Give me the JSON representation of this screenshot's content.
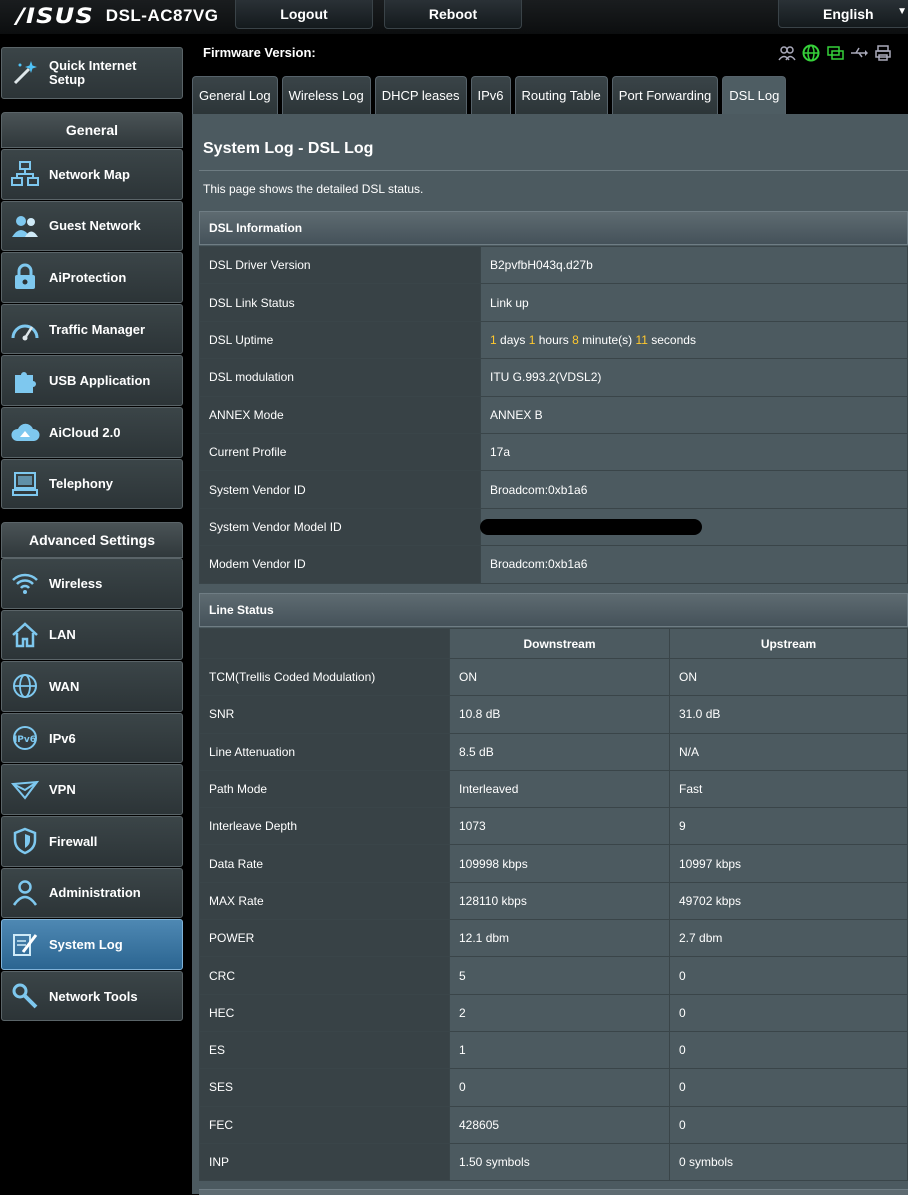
{
  "header": {
    "logo_text": "/ISUS",
    "model": "DSL-AC87VG",
    "logout_label": "Logout",
    "reboot_label": "Reboot",
    "language": "English"
  },
  "sidebar": {
    "quick_setup_line1": "Quick Internet",
    "quick_setup_line2": "Setup",
    "general_title": "General",
    "general_items": [
      {
        "label": "Network Map",
        "icon": "network-map-icon"
      },
      {
        "label": "Guest Network",
        "icon": "guest-network-icon"
      },
      {
        "label": "AiProtection",
        "icon": "lock-icon"
      },
      {
        "label": "Traffic Manager",
        "icon": "gauge-icon"
      },
      {
        "label": "USB Application",
        "icon": "puzzle-icon"
      },
      {
        "label": "AiCloud 2.0",
        "icon": "cloud-icon"
      },
      {
        "label": "Telephony",
        "icon": "telephony-icon"
      }
    ],
    "advanced_title": "Advanced Settings",
    "advanced_items": [
      {
        "label": "Wireless",
        "icon": "wifi-icon"
      },
      {
        "label": "LAN",
        "icon": "home-icon"
      },
      {
        "label": "WAN",
        "icon": "globe-icon"
      },
      {
        "label": "IPv6",
        "icon": "ipv6-icon"
      },
      {
        "label": "VPN",
        "icon": "vpn-icon"
      },
      {
        "label": "Firewall",
        "icon": "shield-icon"
      },
      {
        "label": "Administration",
        "icon": "admin-icon"
      },
      {
        "label": "System Log",
        "icon": "system-log-icon"
      },
      {
        "label": "Network Tools",
        "icon": "tools-icon"
      }
    ]
  },
  "firmware_label": "Firmware Version:",
  "tabs": [
    "General Log",
    "Wireless Log",
    "DHCP leases",
    "IPv6",
    "Routing Table",
    "Port Forwarding",
    "DSL Log"
  ],
  "active_tab": "DSL Log",
  "page": {
    "title": "System Log - DSL Log",
    "description": "This page shows the detailed DSL status."
  },
  "dsl_info": {
    "title": "DSL Information",
    "rows": [
      {
        "key": "DSL Driver Version",
        "value": "B2pvfbH043q.d27b"
      },
      {
        "key": "DSL Link Status",
        "value": "Link up"
      },
      {
        "key": "DSL Uptime",
        "value": ""
      },
      {
        "key": "DSL modulation",
        "value": "ITU G.993.2(VDSL2)"
      },
      {
        "key": "ANNEX Mode",
        "value": "ANNEX B"
      },
      {
        "key": "Current Profile",
        "value": "17a"
      },
      {
        "key": "System Vendor ID",
        "value": "Broadcom:0xb1a6"
      },
      {
        "key": "System Vendor Model ID",
        "value": ""
      },
      {
        "key": "Modem Vendor ID",
        "value": "Broadcom:0xb1a6"
      }
    ],
    "uptime": {
      "days": "1",
      "days_label": "days",
      "hours": "1",
      "hours_label": "hours",
      "minutes": "8",
      "minutes_label": "minute(s)",
      "seconds": "11",
      "seconds_label": "seconds"
    }
  },
  "line_status": {
    "title": "Line Status",
    "col_down": "Downstream",
    "col_up": "Upstream",
    "rows": [
      {
        "key": "TCM(Trellis Coded Modulation)",
        "down": "ON",
        "up": "ON"
      },
      {
        "key": "SNR",
        "down": "10.8 dB",
        "up": "31.0 dB"
      },
      {
        "key": "Line Attenuation",
        "down": "8.5 dB",
        "up": "N/A"
      },
      {
        "key": "Path Mode",
        "down": "Interleaved",
        "up": "Fast"
      },
      {
        "key": "Interleave Depth",
        "down": "1073",
        "up": "9"
      },
      {
        "key": "Data Rate",
        "down": "109998 kbps",
        "up": "10997 kbps"
      },
      {
        "key": "MAX Rate",
        "down": "128110 kbps",
        "up": "49702 kbps"
      },
      {
        "key": "POWER",
        "down": "12.1 dbm",
        "up": "2.7 dbm"
      },
      {
        "key": "CRC",
        "down": "5",
        "up": "0"
      },
      {
        "key": "HEC",
        "down": "2",
        "up": "0"
      },
      {
        "key": "ES",
        "down": "1",
        "up": "0"
      },
      {
        "key": "SES",
        "down": "0",
        "up": "0"
      },
      {
        "key": "FEC",
        "down": "428605",
        "up": "0"
      },
      {
        "key": "INP",
        "down": "1.50 symbols",
        "up": "0 symbols"
      }
    ]
  },
  "colors": {
    "accent_active": "#2b6591",
    "uptime_numbers": "#ffc82e",
    "panel_bg": "#4c5a60"
  }
}
